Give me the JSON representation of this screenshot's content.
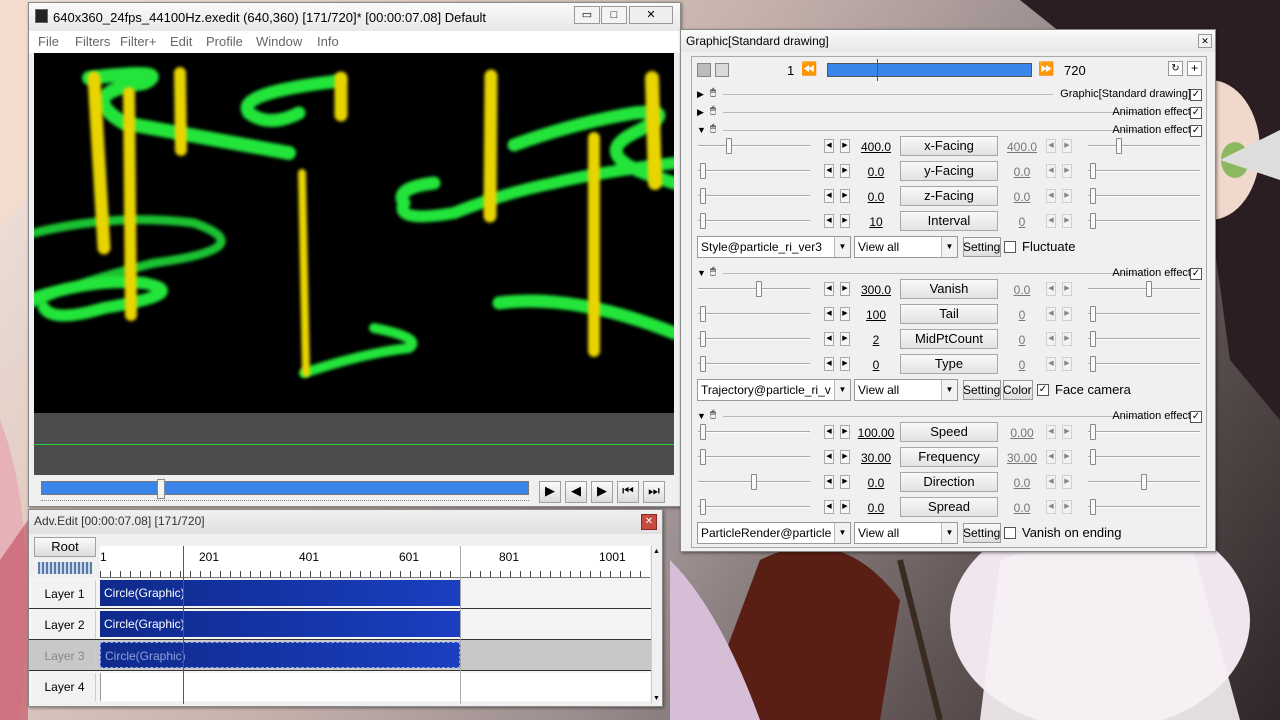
{
  "main_window": {
    "title": "640x360_24fps_44100Hz.exedit (640,360)  [171/720]* [00:00:07.08]  Default",
    "menu": [
      "File",
      "Filters",
      "Filter+",
      "Edit",
      "Profile",
      "Window",
      "Info"
    ],
    "caption": {
      "minimize": "▭",
      "maximize": "□",
      "close": "✕"
    },
    "seek_progress": 0.24,
    "playback_icons": [
      "play-icon",
      "prev-frame-icon",
      "next-frame-icon",
      "go-start-icon",
      "go-end-icon"
    ]
  },
  "timeline": {
    "title": "Adv.Edit [00:00:07.08] [171/720]",
    "root_label": "Root",
    "ruler": [
      "1",
      "201",
      "401",
      "601",
      "801",
      "1001"
    ],
    "layers": [
      {
        "label": "Layer  1",
        "clip": "Circle(Graphic)",
        "hidden": false
      },
      {
        "label": "Layer  2",
        "clip": "Circle(Graphic)",
        "hidden": false
      },
      {
        "label": "Layer  3",
        "clip": "Circle(Graphic)",
        "hidden": true
      },
      {
        "label": "Layer  4",
        "clip": "",
        "hidden": false
      }
    ]
  },
  "graphic": {
    "title": "Graphic[Standard drawing]",
    "frame_start": "1",
    "frame_end": "720",
    "frame_progress": 0.24,
    "headers": [
      {
        "label": "Graphic[Standard drawing]",
        "checked": true
      },
      {
        "label": "Animation effect",
        "checked": true
      },
      {
        "label": "Animation effect",
        "checked": true
      },
      {
        "label": "Animation effect",
        "checked": true
      },
      {
        "label": "Animation effect",
        "checked": true
      }
    ],
    "groups": [
      {
        "params": [
          {
            "name": "x-Facing",
            "val": "400.0",
            "val2": "400.0",
            "pos": 0.26,
            "pos2": 0.26
          },
          {
            "name": "y-Facing",
            "val": "0.0",
            "val2": "0.0",
            "pos": 0.02,
            "pos2": 0.02
          },
          {
            "name": "z-Facing",
            "val": "0.0",
            "val2": "0.0",
            "pos": 0.02,
            "pos2": 0.02
          },
          {
            "name": "Interval",
            "val": "10",
            "val2": "0",
            "pos": 0.02,
            "pos2": 0.02
          }
        ],
        "combo1": "Style@particle_ri_ver3",
        "combo2": "View all",
        "setting": "Setting",
        "extra": "",
        "check_label": "Fluctuate",
        "check_val": false
      },
      {
        "params": [
          {
            "name": "Vanish",
            "val": "300.0",
            "val2": "0.0",
            "pos": 0.55,
            "pos2": 0.55
          },
          {
            "name": "Tail",
            "val": "100",
            "val2": "0",
            "pos": 0.02,
            "pos2": 0.02
          },
          {
            "name": "MidPtCount",
            "val": "2",
            "val2": "0",
            "pos": 0.02,
            "pos2": 0.02
          },
          {
            "name": "Type",
            "val": "0",
            "val2": "0",
            "pos": 0.02,
            "pos2": 0.02
          }
        ],
        "combo1": "Trajectory@particle_ri_v",
        "combo2": "View all",
        "setting": "Setting",
        "extra": "Color",
        "check_label": "Face camera",
        "check_val": true
      },
      {
        "params": [
          {
            "name": "Speed",
            "val": "100.00",
            "val2": "0.00",
            "pos": 0.02,
            "pos2": 0.02
          },
          {
            "name": "Frequency",
            "val": "30.00",
            "val2": "30.00",
            "pos": 0.02,
            "pos2": 0.02
          },
          {
            "name": "Direction",
            "val": "0.0",
            "val2": "0.0",
            "pos": 0.5,
            "pos2": 0.5
          },
          {
            "name": "Spread",
            "val": "0.0",
            "val2": "0.0",
            "pos": 0.02,
            "pos2": 0.02
          }
        ],
        "combo1": "ParticleRender@particle",
        "combo2": "View all",
        "setting": "Setting",
        "extra": "",
        "check_label": "Vanish on ending",
        "check_val": false
      }
    ]
  },
  "colors": {
    "accent": "#3a86e8",
    "clip": "#1533a8",
    "particle_green": "#22e43a",
    "particle_yellow": "#e8d400",
    "playhead": "#d42020"
  }
}
